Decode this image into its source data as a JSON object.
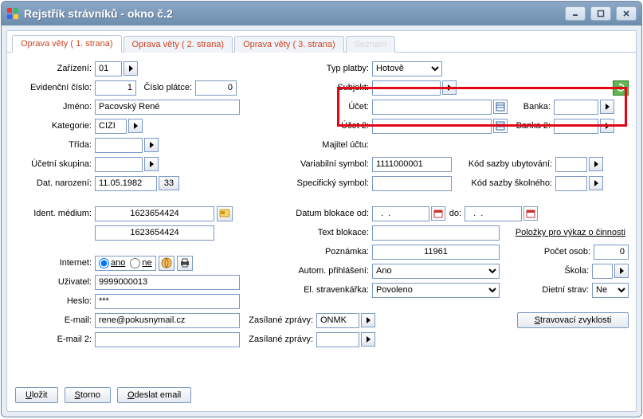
{
  "window": {
    "title": "Rejstřík strávníků - okno č.2"
  },
  "tabs": [
    {
      "label": "Oprava věty ( 1. strana)",
      "active": true
    },
    {
      "label": "Oprava věty ( 2. strana)",
      "active": false
    },
    {
      "label": "Oprava věty ( 3. strana)",
      "active": false
    },
    {
      "label": "Seznam",
      "disabled": true
    }
  ],
  "left": {
    "zarizeni_label": "Zařízení:",
    "zarizeni": "01",
    "evid_label": "Evidenční číslo:",
    "evid": "1",
    "cisloplatce_label": "Číslo plátce:",
    "cisloplatce": "0",
    "jmeno_label": "Jméno:",
    "jmeno": "Pacovský René",
    "kategorie_label": "Kategorie:",
    "kategorie": "CIZI",
    "trida_label": "Třída:",
    "trida": "",
    "uctskup_label": "Účetní skupina:",
    "uctskup": "",
    "datnar_label": "Dat. narození:",
    "datnar": "11.05.1982",
    "age": "33",
    "identmed_label": "Ident. médium:",
    "identmed": "1623654424",
    "identmed2": "1623654424",
    "internet_label": "Internet:",
    "internet_ano": "ano",
    "internet_ne": "ne",
    "uzivatel_label": "Uživatel:",
    "uzivatel": "9999000013",
    "heslo_label": "Heslo:",
    "heslo": "***",
    "email_label": "E-mail:",
    "email": "rene@pokusnymail.cz",
    "email2_label": "E-mail 2:",
    "email2": ""
  },
  "right": {
    "typplatby_label": "Typ platby:",
    "typplatby": "Hotově",
    "subjekt_label": "Subjekt:",
    "subjekt": "",
    "ucet_label": "Účet:",
    "ucet": "",
    "banka_label": "Banka:",
    "banka": "",
    "ucet2_label": "Účet 2:",
    "ucet2": "",
    "banka2_label": "Banka 2:",
    "banka2": "",
    "majitel_label": "Majitel účtu:",
    "majitel": "",
    "varsym_label": "Variabilní symbol:",
    "varsym": "1111000001",
    "specsym_label": "Specifický symbol:",
    "specsym": "",
    "kodubyt_label": "Kód sazby ubytování:",
    "kodubyt": "",
    "kodskol_label": "Kód sazby školného:",
    "kodskol": "",
    "datblok_label": "Datum blokace od:",
    "datblok_od": "  .  .    ",
    "do_label": "do:",
    "datblok_do": "  .  .    ",
    "textblok_label": "Text blokace:",
    "textblok": "",
    "pozn_label": "Poznámka:",
    "pozn": "11961",
    "autoprih_label": "Autom. přihlášení:",
    "autoprih": "Ano",
    "elstrav_label": "El. stravenkářka:",
    "elstrav": "Povoleno",
    "zaszpr_label": "Zasílané zprávy:",
    "zaszpr": "ONMK",
    "zaszpr2_label": "Zasílané zprávy:",
    "zaszpr2": "",
    "polozky_label": "Položky pro výkaz o činnosti",
    "pocetosob_label": "Počet osob:",
    "pocetosob": "0",
    "skola_label": "Škola:",
    "skola": "",
    "dietni_label": "Dietní strav:",
    "dietni": "Ne",
    "stravzvyk_btn": "Stravovací zvyklosti"
  },
  "footer": {
    "ulozit": "Uložit",
    "storno": "Storno",
    "odeslat": "Odeslat email"
  }
}
